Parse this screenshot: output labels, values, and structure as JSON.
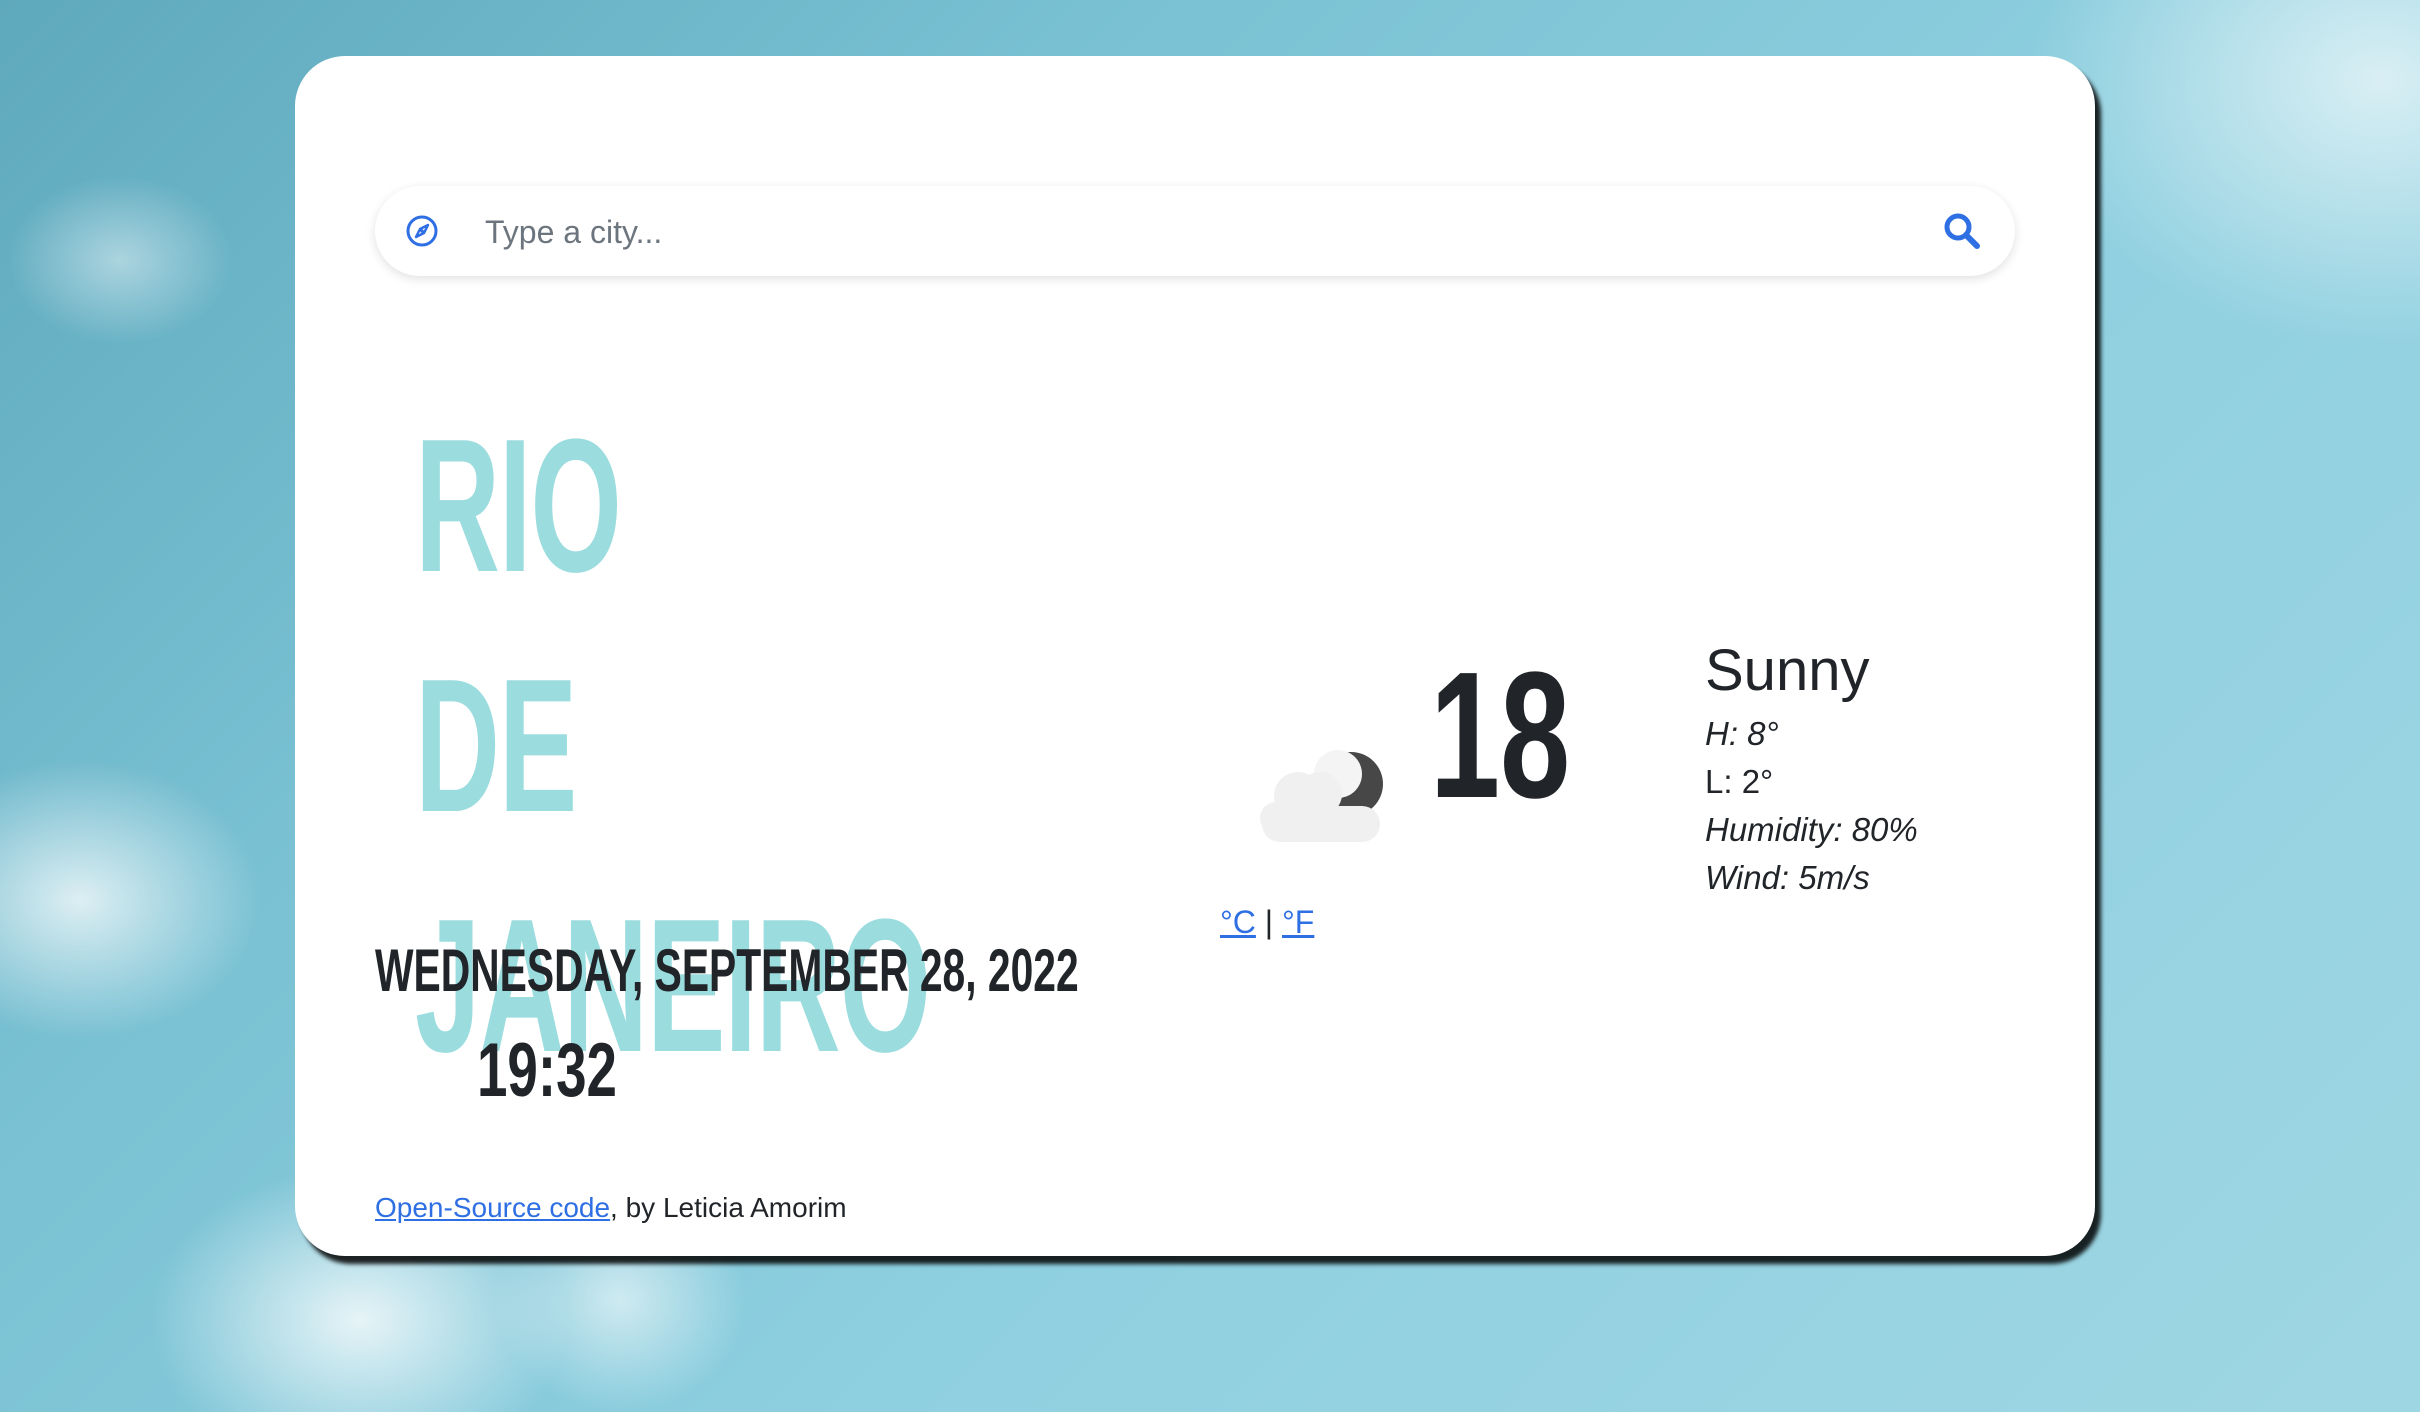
{
  "search": {
    "placeholder": "Type a city..."
  },
  "location": {
    "city": "RIO DE JANEIRO",
    "date": "WEDNESDAY, SEPTEMBER 28, 2022",
    "time": "19:32"
  },
  "weather": {
    "icon": "cloud-moon-icon",
    "temperature": "18",
    "unit_celsius": "°C",
    "unit_separator": "|",
    "unit_fahrenheit": "°F",
    "condition": "Sunny",
    "high": "H: 8°",
    "low": "L: 2°",
    "humidity": "Humidity: 80%",
    "wind": "Wind: 5m/s"
  },
  "footer": {
    "link_text": "Open-Source code",
    "credit": ", by Leticia Amorim"
  },
  "colors": {
    "accent": "#9bdcde",
    "link": "#2f6fe4",
    "icon_blue": "#2f6fe4",
    "text": "#212529"
  }
}
